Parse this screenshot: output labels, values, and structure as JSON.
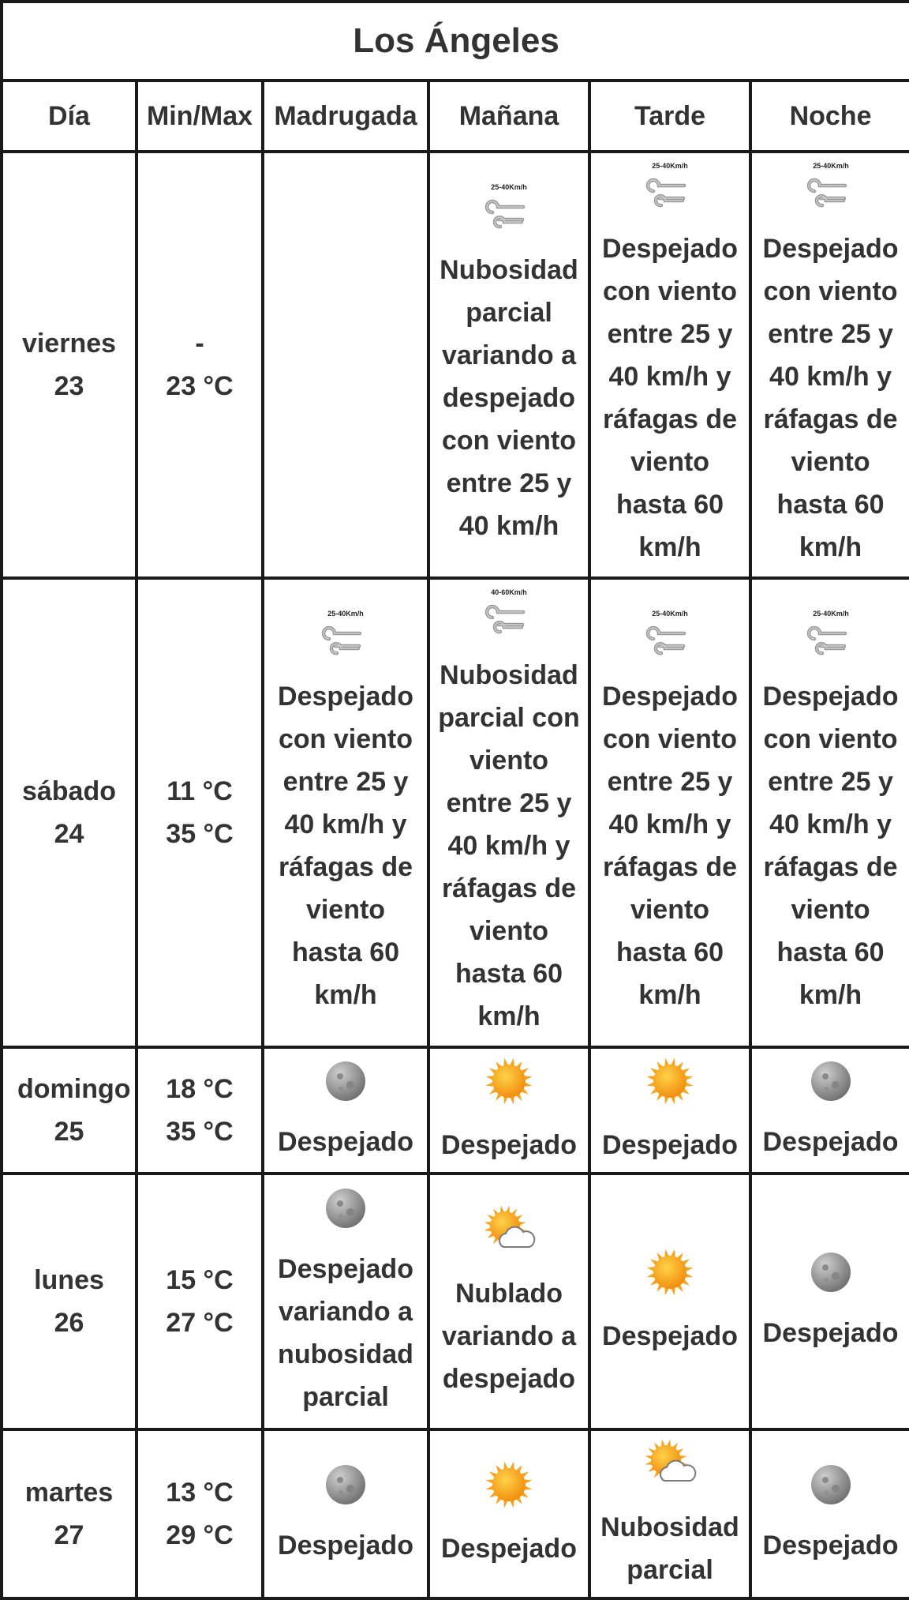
{
  "title": "Los Ángeles",
  "columns": [
    "Día",
    "Min/Max",
    "Madrugada",
    "Mañana",
    "Tarde",
    "Noche"
  ],
  "rows": [
    {
      "day": "viernes 23",
      "min": "-",
      "max": "23 °C",
      "periods": [
        {
          "icon": "",
          "wind_label": "",
          "desc": ""
        },
        {
          "icon": "wind-icon",
          "wind_label": "25-40Km/h",
          "desc": "Nubosidad parcial variando a despejado con viento entre 25 y 40 km/h"
        },
        {
          "icon": "wind-icon",
          "wind_label": "25-40Km/h",
          "desc": "Despejado con viento entre 25 y 40 km/h y ráfagas de viento hasta 60 km/h"
        },
        {
          "icon": "wind-icon",
          "wind_label": "25-40Km/h",
          "desc": "Despejado con viento entre 25 y 40 km/h y ráfagas de viento hasta 60 km/h"
        }
      ]
    },
    {
      "day": "sábado 24",
      "min": "11 °C",
      "max": "35 °C",
      "periods": [
        {
          "icon": "wind-icon",
          "wind_label": "25-40Km/h",
          "desc": "Despejado con viento entre 25 y 40 km/h y ráfagas de viento hasta 60 km/h"
        },
        {
          "icon": "wind-icon",
          "wind_label": "40-60Km/h",
          "desc": "Nubosidad parcial con viento entre 25 y 40 km/h y ráfagas de viento hasta 60 km/h"
        },
        {
          "icon": "wind-icon",
          "wind_label": "25-40Km/h",
          "desc": "Despejado con viento entre 25 y 40 km/h y ráfagas de viento hasta 60 km/h"
        },
        {
          "icon": "wind-icon",
          "wind_label": "25-40Km/h",
          "desc": "Despejado con viento entre 25 y 40 km/h y ráfagas de viento hasta 60 km/h"
        }
      ]
    },
    {
      "day": "domingo 25",
      "min": "18 °C",
      "max": "35 °C",
      "periods": [
        {
          "icon": "moon-icon",
          "wind_label": "",
          "desc": "Despejado"
        },
        {
          "icon": "sun-icon",
          "wind_label": "",
          "desc": "Despejado"
        },
        {
          "icon": "sun-icon",
          "wind_label": "",
          "desc": "Despejado"
        },
        {
          "icon": "moon-icon",
          "wind_label": "",
          "desc": "Despejado"
        }
      ]
    },
    {
      "day": "lunes 26",
      "min": "15 °C",
      "max": "27 °C",
      "periods": [
        {
          "icon": "moon-icon",
          "wind_label": "",
          "desc": "Despejado variando a nubosidad parcial"
        },
        {
          "icon": "sun-cloud-icon",
          "wind_label": "",
          "desc": "Nublado variando a despejado"
        },
        {
          "icon": "sun-icon",
          "wind_label": "",
          "desc": "Despejado"
        },
        {
          "icon": "moon-icon",
          "wind_label": "",
          "desc": "Despejado"
        }
      ]
    },
    {
      "day": "martes 27",
      "min": "13 °C",
      "max": "29 °C",
      "periods": [
        {
          "icon": "moon-icon",
          "wind_label": "",
          "desc": "Despejado"
        },
        {
          "icon": "sun-icon",
          "wind_label": "",
          "desc": "Despejado"
        },
        {
          "icon": "sun-cloud-icon",
          "wind_label": "",
          "desc": "Nubosidad parcial"
        },
        {
          "icon": "moon-icon",
          "wind_label": "",
          "desc": "Despejado"
        }
      ]
    }
  ]
}
